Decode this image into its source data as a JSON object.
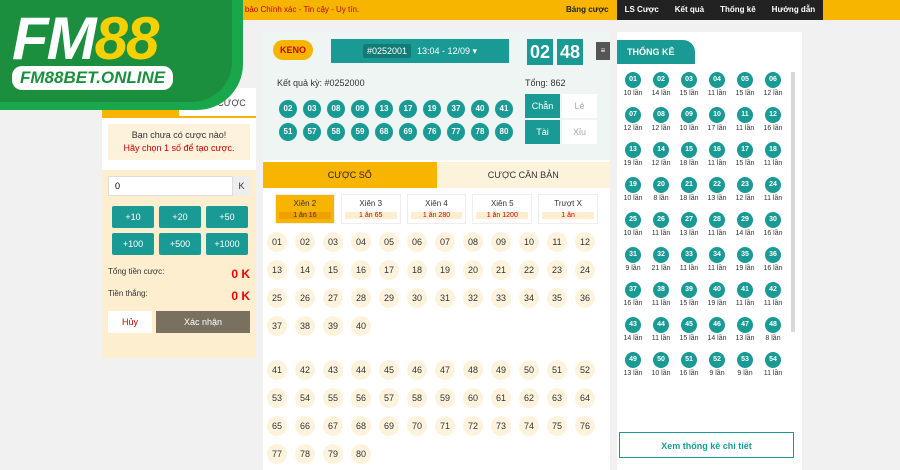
{
  "topbar": {
    "tagline": "m bảo Chính xác - Tin cậy - Uy tín.",
    "menu": [
      "Bảng cược",
      "LS Cược",
      "Kết quả",
      "Thống kê",
      "Hướng dẫn"
    ]
  },
  "logo": {
    "fm": "FM",
    "n88": "88",
    "url": "FM88BET.ONLINE"
  },
  "left": {
    "tabs": [
      "",
      "BẢNG CƯỢC"
    ],
    "notice1": "Bạn chưa có cược nào!",
    "notice2": "Hãy chọn 1 số để tạo cược.",
    "amount": "0",
    "unit": "K",
    "quick": [
      "+10",
      "+20",
      "+50",
      "+100",
      "+500",
      "+1000"
    ],
    "total_label": "Tổng tiền cược:",
    "total_value": "0 K",
    "win_label": "Tiền thắng:",
    "win_value": "0 K",
    "cancel": "Hủy",
    "confirm": "Xác nhận"
  },
  "center": {
    "keno": "KENO",
    "draw_id": "#0252001",
    "draw_time": "13:04 - 12/09 ▾",
    "minutes": "02",
    "seconds": "48",
    "result_title": "Kết quả kỳ: #0252000",
    "total": "Tổng: 862",
    "balls": [
      "02",
      "03",
      "08",
      "09",
      "13",
      "17",
      "19",
      "37",
      "40",
      "41",
      "51",
      "57",
      "58",
      "59",
      "68",
      "69",
      "76",
      "77",
      "78",
      "80"
    ],
    "chan": "Chẵn",
    "le": "Lẻ",
    "tai": "Tài",
    "xiu": "Xỉu",
    "tabs": [
      "CƯỢC SỐ",
      "CƯỢC CĂN BẢN"
    ],
    "bettypes": [
      {
        "name": "Xiên 2",
        "rate": "1 ăn 16"
      },
      {
        "name": "Xiên 3",
        "rate": "1 ăn 65"
      },
      {
        "name": "Xiên 4",
        "rate": "1 ăn 280"
      },
      {
        "name": "Xiên 5",
        "rate": "1 ăn 1200"
      },
      {
        "name": "Trượt X",
        "rate": "1 ăn"
      }
    ],
    "grid1": [
      "01",
      "02",
      "03",
      "04",
      "05",
      "06",
      "07",
      "08",
      "09",
      "10",
      "11",
      "12",
      "13",
      "14",
      "15",
      "16",
      "17",
      "18",
      "19",
      "20",
      "21",
      "22",
      "23",
      "24",
      "25",
      "26",
      "27",
      "28",
      "29",
      "30",
      "31",
      "32",
      "33",
      "34",
      "35",
      "36",
      "37",
      "38",
      "39",
      "40"
    ],
    "grid2": [
      "41",
      "42",
      "43",
      "44",
      "45",
      "46",
      "47",
      "48",
      "49",
      "50",
      "51",
      "52",
      "53",
      "54",
      "55",
      "56",
      "57",
      "58",
      "59",
      "60",
      "61",
      "62",
      "63",
      "64",
      "65",
      "66",
      "67",
      "68",
      "69",
      "70",
      "71",
      "72",
      "73",
      "74",
      "75",
      "76",
      "77",
      "78",
      "79",
      "80"
    ]
  },
  "right": {
    "title": "THỐNG KÊ",
    "see_more": "Xem thống kê chi tiết",
    "stats": [
      [
        "01",
        "10 lần"
      ],
      [
        "02",
        "14 lần"
      ],
      [
        "03",
        "15 lần"
      ],
      [
        "04",
        "11 lần"
      ],
      [
        "05",
        "15 lần"
      ],
      [
        "06",
        "12 lần"
      ],
      [
        "07",
        "12 lần"
      ],
      [
        "08",
        "12 lần"
      ],
      [
        "09",
        "10 lần"
      ],
      [
        "10",
        "17 lần"
      ],
      [
        "11",
        "11 lần"
      ],
      [
        "12",
        "16 lần"
      ],
      [
        "13",
        "19 lần"
      ],
      [
        "14",
        "12 lần"
      ],
      [
        "15",
        "18 lần"
      ],
      [
        "16",
        "11 lần"
      ],
      [
        "17",
        "15 lần"
      ],
      [
        "18",
        "11 lần"
      ],
      [
        "19",
        "10 lần"
      ],
      [
        "20",
        "8 lần"
      ],
      [
        "21",
        "18 lần"
      ],
      [
        "22",
        "13 lần"
      ],
      [
        "23",
        "12 lần"
      ],
      [
        "24",
        "11 lần"
      ],
      [
        "25",
        "10 lần"
      ],
      [
        "26",
        "11 lần"
      ],
      [
        "27",
        "13 lần"
      ],
      [
        "28",
        "11 lần"
      ],
      [
        "29",
        "14 lần"
      ],
      [
        "30",
        "16 lần"
      ],
      [
        "31",
        "9 lần"
      ],
      [
        "32",
        "21 lần"
      ],
      [
        "33",
        "11 lần"
      ],
      [
        "34",
        "11 lần"
      ],
      [
        "35",
        "19 lần"
      ],
      [
        "36",
        "16 lần"
      ],
      [
        "37",
        "16 lần"
      ],
      [
        "38",
        "11 lần"
      ],
      [
        "39",
        "15 lần"
      ],
      [
        "40",
        "19 lần"
      ],
      [
        "41",
        "11 lần"
      ],
      [
        "42",
        "11 lần"
      ],
      [
        "43",
        "14 lần"
      ],
      [
        "44",
        "11 lần"
      ],
      [
        "45",
        "15 lần"
      ],
      [
        "46",
        "14 lần"
      ],
      [
        "47",
        "13 lần"
      ],
      [
        "48",
        "8 lần"
      ],
      [
        "49",
        "13 lần"
      ],
      [
        "50",
        "10 lần"
      ],
      [
        "51",
        "16 lần"
      ],
      [
        "52",
        "9 lần"
      ],
      [
        "53",
        "9 lần"
      ],
      [
        "54",
        "11 lần"
      ]
    ]
  },
  "colors": {
    "teal": "#1a9a94",
    "gold": "#f7b500",
    "green": "#1b8f3e"
  }
}
